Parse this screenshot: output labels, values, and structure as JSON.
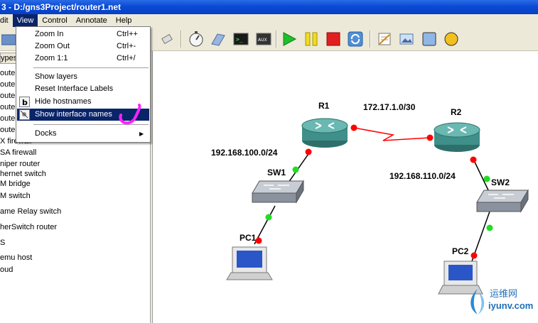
{
  "window": {
    "title": "3 - D:/gns3Project/router1.net"
  },
  "menubar": {
    "items": [
      {
        "label": "dit"
      },
      {
        "label": "View"
      },
      {
        "label": "Control"
      },
      {
        "label": "Annotate"
      },
      {
        "label": "Help"
      }
    ]
  },
  "view_menu": {
    "zoom_in": {
      "label": "Zoom In",
      "shortcut": "Ctrl++"
    },
    "zoom_out": {
      "label": "Zoom Out",
      "shortcut": "Ctrl+-"
    },
    "zoom_reset": {
      "label": "Zoom 1:1",
      "shortcut": "Ctrl+/"
    },
    "show_layers": {
      "label": "Show layers"
    },
    "reset_labels": {
      "label": "Reset Interface Labels"
    },
    "hide_hostnames": {
      "label": "Hide hostnames"
    },
    "show_iface_names": {
      "label": "Show interface names"
    },
    "docks": {
      "label": "Docks"
    }
  },
  "dock": {
    "header": "ypes",
    "items": [
      "outer",
      "outer",
      "outer",
      "outer",
      "outer",
      "outer",
      "X firewall",
      "SA firewall",
      "niper router",
      "hernet switch",
      "M bridge",
      "M switch",
      "ame Relay switch",
      "herSwitch router",
      "S",
      "emu host",
      "oud"
    ]
  },
  "topology": {
    "nodes": {
      "r1": "R1",
      "r2": "R2",
      "sw1": "SW1",
      "sw2": "SW2",
      "pc1": "PC1",
      "pc2": "PC2"
    },
    "networks": {
      "wan": "172.17.1.0/30",
      "lan1": "192.168.100.0/24",
      "lan2": "192.168.110.0/24"
    }
  },
  "watermark": {
    "cn": "运维网",
    "url": "iyunv.com"
  },
  "colors": {
    "link_up": "#22dd22",
    "link_down": "#ff0000",
    "router": "#3f8f8a",
    "menu_highlight": "#0a246a"
  }
}
